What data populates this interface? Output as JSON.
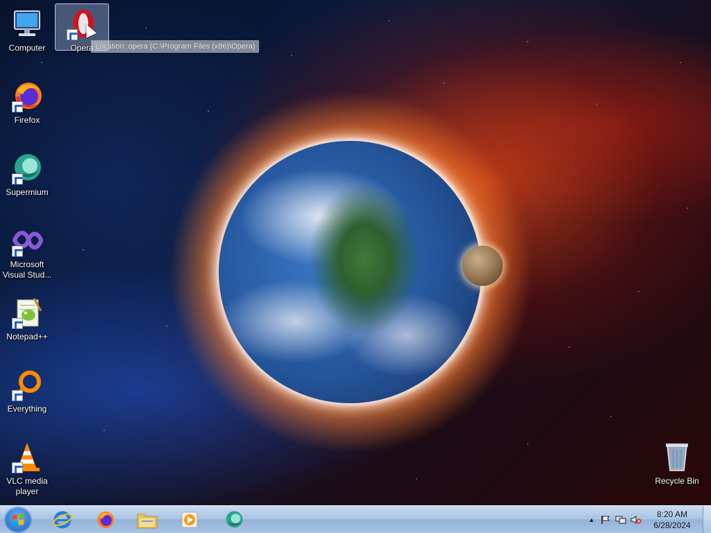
{
  "desktop": {
    "icons": [
      {
        "label": "Computer"
      },
      {
        "label": "Opera"
      },
      {
        "label": "Firefox"
      },
      {
        "label": "Supermium"
      },
      {
        "label": "Microsoft Visual Stud..."
      },
      {
        "label": "Notepad++"
      },
      {
        "label": "Everything"
      },
      {
        "label": "VLC media player"
      },
      {
        "label": "Recycle Bin"
      }
    ],
    "tooltip": "Location: opera (C:\\Program Files (x86)\\Opera)"
  },
  "taskbar": {
    "pinned": [
      "start-orb",
      "internet-explorer-icon",
      "firefox-icon",
      "file-explorer-icon",
      "media-player-icon",
      "supermium-icon"
    ],
    "clock": {
      "time": "8:20 AM",
      "date": "6/28/2024"
    }
  },
  "colors": {
    "taskbar_top": "#c9dcf0",
    "taskbar_bottom": "#94b2d8",
    "selection": "#bed2f0"
  }
}
